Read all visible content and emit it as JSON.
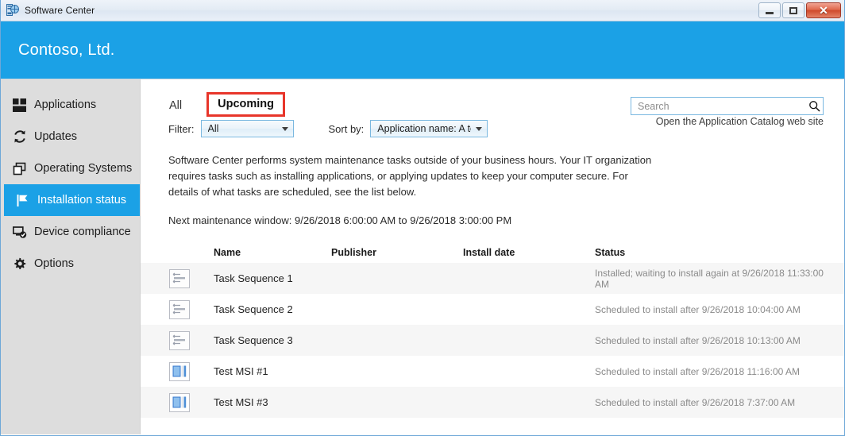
{
  "window": {
    "title": "Software Center",
    "app_icon": "software-center-icon",
    "controls": {
      "minimize": "Minimize",
      "maximize": "Maximize",
      "close": "Close"
    }
  },
  "banner": {
    "organization": "Contoso, Ltd.",
    "background_color": "#1ba1e6"
  },
  "sidebar": {
    "background_color": "#dddddd",
    "active_color": "#1ba1e6",
    "items": [
      {
        "label": "Applications",
        "icon": "applications-icon",
        "active": false
      },
      {
        "label": "Updates",
        "icon": "updates-refresh-icon",
        "active": false
      },
      {
        "label": "Operating Systems",
        "icon": "operating-systems-icon",
        "active": false
      },
      {
        "label": "Installation status",
        "icon": "flag-icon",
        "active": true
      },
      {
        "label": "Device compliance",
        "icon": "device-compliance-icon",
        "active": false
      },
      {
        "label": "Options",
        "icon": "gear-icon",
        "active": false
      }
    ]
  },
  "content": {
    "tabs": [
      {
        "label": "All",
        "active": false,
        "highlighted": false
      },
      {
        "label": "Upcoming",
        "active": true,
        "highlighted": true
      }
    ],
    "highlight_color": "#e8352a",
    "search": {
      "placeholder": "Search",
      "value": "",
      "icon": "search-icon"
    },
    "catalog_link": "Open the Application Catalog web site",
    "filter": {
      "label": "Filter:",
      "value": "All"
    },
    "sort": {
      "label": "Sort by:",
      "value": "Application name: A to Z"
    },
    "description": "Software Center performs system maintenance tasks outside of your business hours. Your IT organization requires tasks such as installing applications, or applying updates to keep your computer secure. For details of what tasks are scheduled, see the list below.",
    "maintenance_window": "Next maintenance window: 9/26/2018 6:00:00 AM to 9/26/2018 3:00:00 PM",
    "table": {
      "columns": [
        "Name",
        "Publisher",
        "Install date",
        "Status"
      ],
      "rows": [
        {
          "icon": "task-sequence-icon",
          "name": "Task Sequence 1",
          "publisher": "",
          "install_date": "",
          "status": "Installed; waiting to install again at 9/26/2018 11:33:00 AM"
        },
        {
          "icon": "task-sequence-icon",
          "name": "Task Sequence 2",
          "publisher": "",
          "install_date": "",
          "status": "Scheduled to install after 9/26/2018 10:04:00 AM"
        },
        {
          "icon": "task-sequence-icon",
          "name": "Task Sequence 3",
          "publisher": "",
          "install_date": "",
          "status": "Scheduled to install after 9/26/2018 10:13:00 AM"
        },
        {
          "icon": "msi-package-icon",
          "name": "Test MSI #1",
          "publisher": "",
          "install_date": "",
          "status": "Scheduled to install after 9/26/2018 11:16:00 AM"
        },
        {
          "icon": "msi-package-icon",
          "name": "Test MSI #3",
          "publisher": "",
          "install_date": "",
          "status": "Scheduled to install after 9/26/2018 7:37:00 AM"
        }
      ]
    }
  }
}
